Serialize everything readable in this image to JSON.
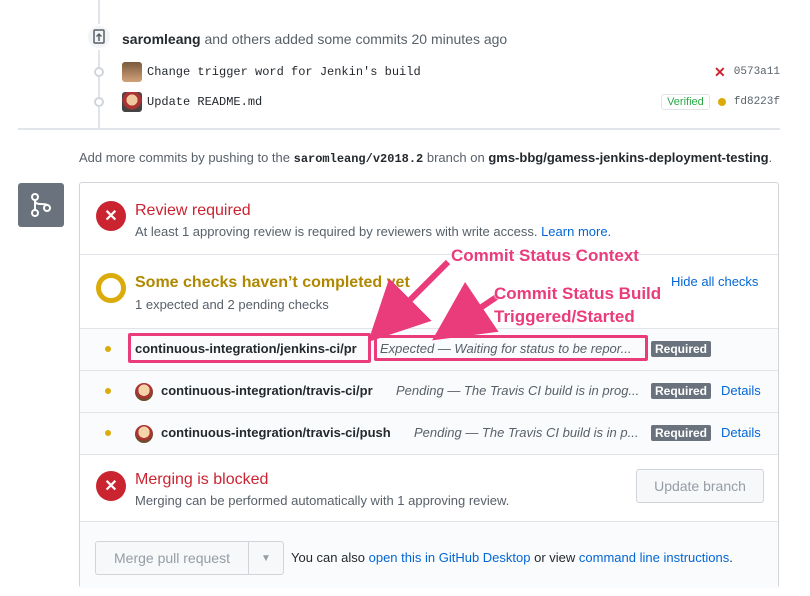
{
  "push": {
    "user": "saromleang",
    "text": "and others added some commits 20 minutes ago"
  },
  "commits": [
    {
      "message": "Change trigger word for Jenkin's build",
      "sha": "0573a11",
      "status": "failure"
    },
    {
      "message": "Update README.md",
      "sha": "fd8223f",
      "status": "pending",
      "verified": "Verified"
    }
  ],
  "add_more": {
    "prefix": "Add more commits by pushing to the",
    "branch": "saromleang/v2018.2",
    "middle": "branch on",
    "repo": "gms-bbg/gamess-jenkins-deployment-testing",
    "suffix": "."
  },
  "review": {
    "title": "Review required",
    "subtitle": "At least 1 approving review is required by reviewers with write access.",
    "learn_more": "Learn more."
  },
  "checks": {
    "title": "Some checks haven’t completed yet",
    "subtitle": "1 expected and 2 pending checks",
    "toggle": "Hide all checks",
    "rows": [
      {
        "context": "continuous-integration/jenkins-ci/pr",
        "description": "Expected — Waiting for status to be repor...",
        "required": "Required",
        "details": ""
      },
      {
        "context": "continuous-integration/travis-ci/pr",
        "description": "Pending — The Travis CI build is in prog...",
        "required": "Required",
        "details": "Details"
      },
      {
        "context": "continuous-integration/travis-ci/push",
        "description": "Pending — The Travis CI build is in p...",
        "required": "Required",
        "details": "Details"
      }
    ]
  },
  "blocked": {
    "title": "Merging is blocked",
    "subtitle": "Merging can be performed automatically with 1 approving review.",
    "update_button": "Update branch"
  },
  "merge": {
    "button": "Merge pull request",
    "also_prefix": "You can also",
    "desktop_link": "open this in GitHub Desktop",
    "or_view": "or view",
    "cli_link": "command line instructions",
    "suffix": "."
  },
  "annotations": {
    "context": "Commit Status Context",
    "build_line1": "Commit Status Build",
    "build_line2": "Triggered/Started"
  },
  "colors": {
    "annotation": "#ea3b7a",
    "error": "#cb2431",
    "pending": "#dbab09",
    "link": "#0366d6"
  }
}
